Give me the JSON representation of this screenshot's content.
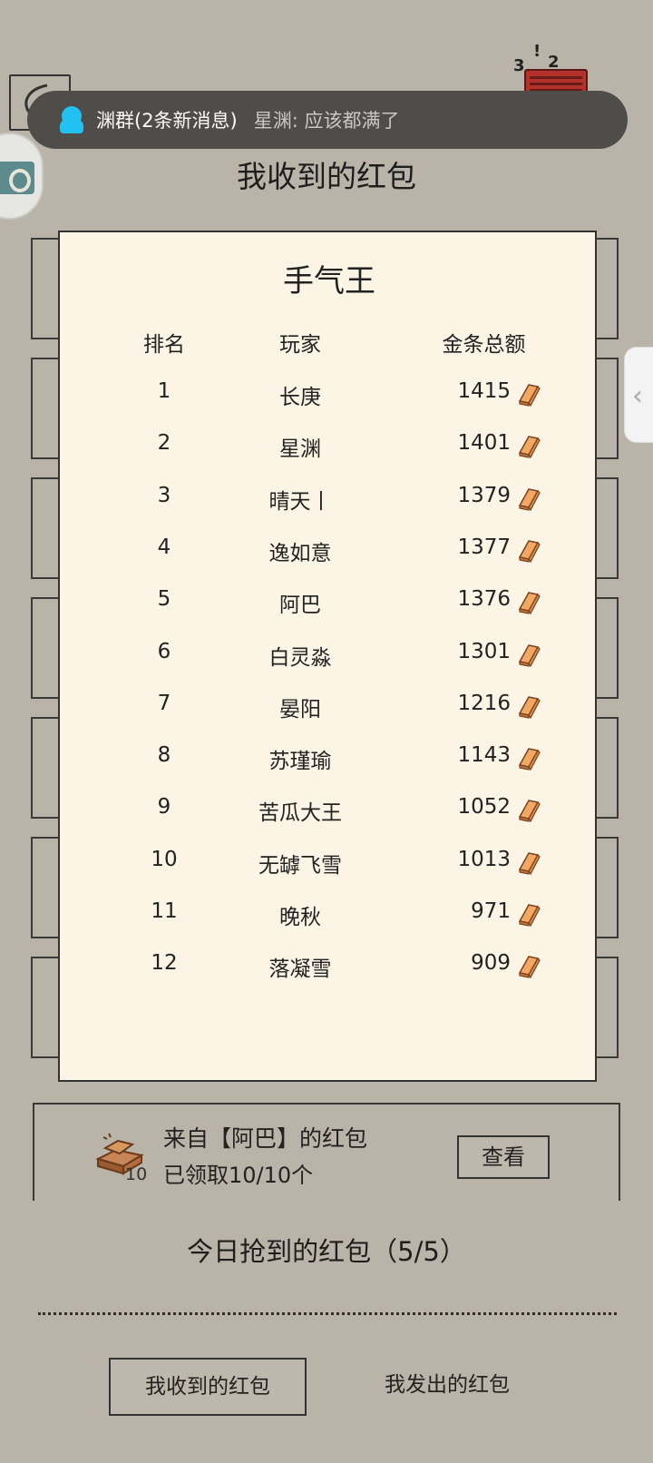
{
  "notification": {
    "group": "渊群(2条新消息)",
    "message": "星渊: 应该都满了"
  },
  "header": {
    "title": "我收到的红包",
    "stack_labels": [
      "3",
      "!",
      "2"
    ]
  },
  "ranking": {
    "title": "手气王",
    "columns": [
      "排名",
      "玩家",
      "金条总额"
    ],
    "rows": [
      {
        "rank": "1",
        "player": "长庚",
        "amount": "1415"
      },
      {
        "rank": "2",
        "player": "星渊",
        "amount": "1401"
      },
      {
        "rank": "3",
        "player": "晴天丨",
        "amount": "1379"
      },
      {
        "rank": "4",
        "player": "逸如意",
        "amount": "1377"
      },
      {
        "rank": "5",
        "player": "阿巴",
        "amount": "1376"
      },
      {
        "rank": "6",
        "player": "白灵淼",
        "amount": "1301"
      },
      {
        "rank": "7",
        "player": "晏阳",
        "amount": "1216"
      },
      {
        "rank": "8",
        "player": "苏瑾瑜",
        "amount": "1143"
      },
      {
        "rank": "9",
        "player": "苦瓜大王",
        "amount": "1052"
      },
      {
        "rank": "10",
        "player": "无罅飞雪",
        "amount": "1013"
      },
      {
        "rank": "11",
        "player": "晚秋",
        "amount": "971"
      },
      {
        "rank": "12",
        "player": "落凝雪",
        "amount": "909"
      }
    ]
  },
  "red_packet": {
    "from": "来自【阿巴】的红包",
    "claimed": "已领取10/10个",
    "count": "10",
    "view_label": "查看"
  },
  "today": {
    "label": "今日抢到的红包（5/5）"
  },
  "tabs": {
    "received": "我收到的红包",
    "sent": "我发出的红包"
  },
  "colors": {
    "background": "#b9b4a7",
    "panel": "#fcf5e5",
    "gold": "#e89a4a",
    "notice_bar": "#4e4d4a"
  }
}
